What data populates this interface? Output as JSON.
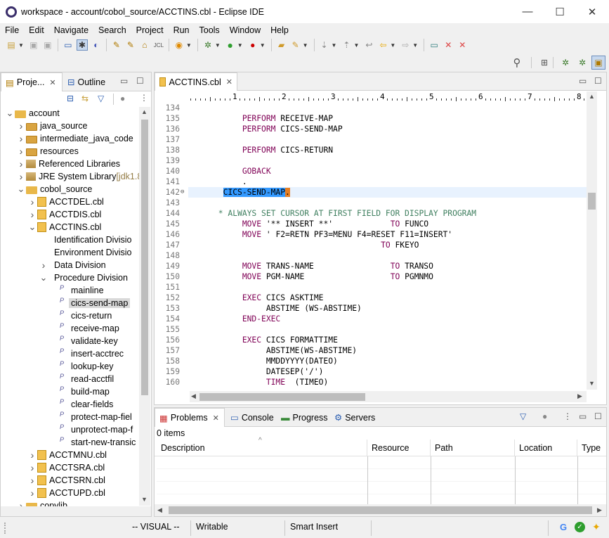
{
  "window": {
    "title": "workspace - account/cobol_source/ACCTINS.cbl - Eclipse IDE",
    "minimize": "—",
    "maximize": "☐",
    "close": "✕"
  },
  "menu": [
    "File",
    "Edit",
    "Navigate",
    "Search",
    "Project",
    "Run",
    "Tools",
    "Window",
    "Help"
  ],
  "left_panel": {
    "tabs": [
      {
        "label": "Proje..."
      },
      {
        "label": "Outline"
      }
    ],
    "tree": [
      {
        "label": "account",
        "level": 0,
        "twisty": "open",
        "icon": "project-folder-icon"
      },
      {
        "label": "java_source",
        "level": 1,
        "twisty": "closed",
        "icon": "package-folder-icon"
      },
      {
        "label": "intermediate_java_code",
        "level": 1,
        "twisty": "closed",
        "icon": "package-folder-icon"
      },
      {
        "label": "resources",
        "level": 1,
        "twisty": "closed",
        "icon": "package-folder-icon"
      },
      {
        "label": "Referenced Libraries",
        "level": 1,
        "twisty": "closed",
        "icon": "library-icon"
      },
      {
        "label": "JRE System Library",
        "extra": "[jdk1.8.",
        "level": 1,
        "twisty": "closed",
        "icon": "library-icon"
      },
      {
        "label": "cobol_source",
        "level": 1,
        "twisty": "open",
        "icon": "folder-icon"
      },
      {
        "label": "ACCTDEL.cbl",
        "level": 2,
        "twisty": "closed",
        "icon": "cobol-file-icon"
      },
      {
        "label": "ACCTDIS.cbl",
        "level": 2,
        "twisty": "closed",
        "icon": "cobol-file-icon"
      },
      {
        "label": "ACCTINS.cbl",
        "level": 2,
        "twisty": "open",
        "icon": "cobol-file-icon"
      },
      {
        "label": "Identification Divisio",
        "level": 3,
        "twisty": "none",
        "icon": "none"
      },
      {
        "label": "Environment Divisio",
        "level": 3,
        "twisty": "none",
        "icon": "none"
      },
      {
        "label": "Data Division",
        "level": 3,
        "twisty": "closed",
        "icon": "none"
      },
      {
        "label": "Procedure Division",
        "level": 3,
        "twisty": "open",
        "icon": "none"
      },
      {
        "label": "mainline",
        "level": 4,
        "twisty": "none",
        "icon": "paragraph-icon"
      },
      {
        "label": "cics-send-map",
        "level": 4,
        "twisty": "none",
        "icon": "paragraph-icon",
        "selected": true
      },
      {
        "label": "cics-return",
        "level": 4,
        "twisty": "none",
        "icon": "paragraph-icon"
      },
      {
        "label": "receive-map",
        "level": 4,
        "twisty": "none",
        "icon": "paragraph-icon"
      },
      {
        "label": "validate-key",
        "level": 4,
        "twisty": "none",
        "icon": "paragraph-icon"
      },
      {
        "label": "insert-acctrec",
        "level": 4,
        "twisty": "none",
        "icon": "paragraph-icon"
      },
      {
        "label": "lookup-key",
        "level": 4,
        "twisty": "none",
        "icon": "paragraph-icon"
      },
      {
        "label": "read-acctfil",
        "level": 4,
        "twisty": "none",
        "icon": "paragraph-icon"
      },
      {
        "label": "build-map",
        "level": 4,
        "twisty": "none",
        "icon": "paragraph-icon"
      },
      {
        "label": "clear-fields",
        "level": 4,
        "twisty": "none",
        "icon": "paragraph-icon"
      },
      {
        "label": "protect-map-fiel",
        "level": 4,
        "twisty": "none",
        "icon": "paragraph-icon"
      },
      {
        "label": "unprotect-map-f",
        "level": 4,
        "twisty": "none",
        "icon": "paragraph-icon"
      },
      {
        "label": "start-new-transic",
        "level": 4,
        "twisty": "none",
        "icon": "paragraph-icon"
      },
      {
        "label": "ACCTMNU.cbl",
        "level": 2,
        "twisty": "closed",
        "icon": "cobol-file-icon"
      },
      {
        "label": "ACCTSRA.cbl",
        "level": 2,
        "twisty": "closed",
        "icon": "cobol-file-icon"
      },
      {
        "label": "ACCTSRN.cbl",
        "level": 2,
        "twisty": "closed",
        "icon": "cobol-file-icon"
      },
      {
        "label": "ACCTUPD.cbl",
        "level": 2,
        "twisty": "closed",
        "icon": "cobol-file-icon"
      },
      {
        "label": "copylib",
        "level": 1,
        "twisty": "closed",
        "icon": "folder-icon"
      }
    ]
  },
  "editor": {
    "tab_label": "ACCTINS.cbl",
    "ruler": [
      "1",
      "2",
      "3",
      "4",
      "5",
      "6",
      "7",
      "8"
    ],
    "lines": [
      {
        "n": "134",
        "segs": []
      },
      {
        "n": "135",
        "segs": [
          {
            "t": "           "
          },
          {
            "t": "PERFORM",
            "k": "kw"
          },
          {
            "t": " RECEIVE-MAP"
          }
        ]
      },
      {
        "n": "136",
        "segs": [
          {
            "t": "           "
          },
          {
            "t": "PERFORM",
            "k": "kw"
          },
          {
            "t": " CICS-SEND-MAP"
          }
        ]
      },
      {
        "n": "137",
        "segs": []
      },
      {
        "n": "138",
        "segs": [
          {
            "t": "           "
          },
          {
            "t": "PERFORM",
            "k": "kw"
          },
          {
            "t": " CICS-RETURN"
          }
        ]
      },
      {
        "n": "139",
        "segs": []
      },
      {
        "n": "140",
        "segs": [
          {
            "t": "           "
          },
          {
            "t": "GOBACK",
            "k": "kw"
          }
        ]
      },
      {
        "n": "141",
        "segs": [
          {
            "t": "           ."
          }
        ]
      },
      {
        "n": "142",
        "segs": [
          {
            "t": "       "
          },
          {
            "t": "CICS-SEND-MAP",
            "k": "sel"
          },
          {
            "t": ".",
            "k": "cursor"
          }
        ],
        "current": true
      },
      {
        "n": "143",
        "segs": []
      },
      {
        "n": "144",
        "segs": [
          {
            "t": "      * ALWAYS SET CURSOR AT FIRST FIELD FOR DISPLAY PROGRAM",
            "k": "cm"
          }
        ]
      },
      {
        "n": "145",
        "segs": [
          {
            "t": "           "
          },
          {
            "t": "MOVE",
            "k": "kw"
          },
          {
            "t": " '** INSERT **'            "
          },
          {
            "t": "TO",
            "k": "kw"
          },
          {
            "t": " FUNCO"
          }
        ]
      },
      {
        "n": "146",
        "segs": [
          {
            "t": "           "
          },
          {
            "t": "MOVE",
            "k": "kw"
          },
          {
            "t": " ' F2=RETN PF3=MENU F4=RESET F11=INSERT'"
          }
        ]
      },
      {
        "n": "147",
        "segs": [
          {
            "t": "                                        "
          },
          {
            "t": "TO",
            "k": "kw"
          },
          {
            "t": " FKEYO"
          }
        ]
      },
      {
        "n": "148",
        "segs": []
      },
      {
        "n": "149",
        "segs": [
          {
            "t": "           "
          },
          {
            "t": "MOVE",
            "k": "kw"
          },
          {
            "t": " TRANS-NAME                "
          },
          {
            "t": "TO",
            "k": "kw"
          },
          {
            "t": " TRANSO"
          }
        ]
      },
      {
        "n": "150",
        "segs": [
          {
            "t": "           "
          },
          {
            "t": "MOVE",
            "k": "kw"
          },
          {
            "t": " PGM-NAME                  "
          },
          {
            "t": "TO",
            "k": "kw"
          },
          {
            "t": " PGMNMO"
          }
        ]
      },
      {
        "n": "151",
        "segs": []
      },
      {
        "n": "152",
        "segs": [
          {
            "t": "           "
          },
          {
            "t": "EXEC",
            "k": "kw"
          },
          {
            "t": " CICS ASKTIME"
          }
        ]
      },
      {
        "n": "153",
        "segs": [
          {
            "t": "                ABSTIME (WS-ABSTIME)"
          }
        ]
      },
      {
        "n": "154",
        "segs": [
          {
            "t": "           "
          },
          {
            "t": "END-EXEC",
            "k": "kw"
          }
        ]
      },
      {
        "n": "155",
        "segs": []
      },
      {
        "n": "156",
        "segs": [
          {
            "t": "           "
          },
          {
            "t": "EXEC",
            "k": "kw"
          },
          {
            "t": " CICS FORMATTIME"
          }
        ]
      },
      {
        "n": "157",
        "segs": [
          {
            "t": "                ABSTIME(WS-ABSTIME)"
          }
        ]
      },
      {
        "n": "158",
        "segs": [
          {
            "t": "                MMDDYYYY(DATEO)"
          }
        ]
      },
      {
        "n": "159",
        "segs": [
          {
            "t": "                DATESEP('/')"
          }
        ]
      },
      {
        "n": "160",
        "segs": [
          {
            "t": "                "
          },
          {
            "t": "TIME",
            "k": "kw"
          },
          {
            "t": "  (TIMEO)"
          }
        ]
      }
    ]
  },
  "bottom_panel": {
    "tabs": [
      "Problems",
      "Console",
      "Progress",
      "Servers"
    ],
    "count_text": "0 items",
    "columns": [
      "Description",
      "Resource",
      "Path",
      "Location",
      "Type"
    ]
  },
  "status_bar": {
    "mode": "-- VISUAL --",
    "writable": "Writable",
    "insert_mode": "Smart Insert"
  }
}
